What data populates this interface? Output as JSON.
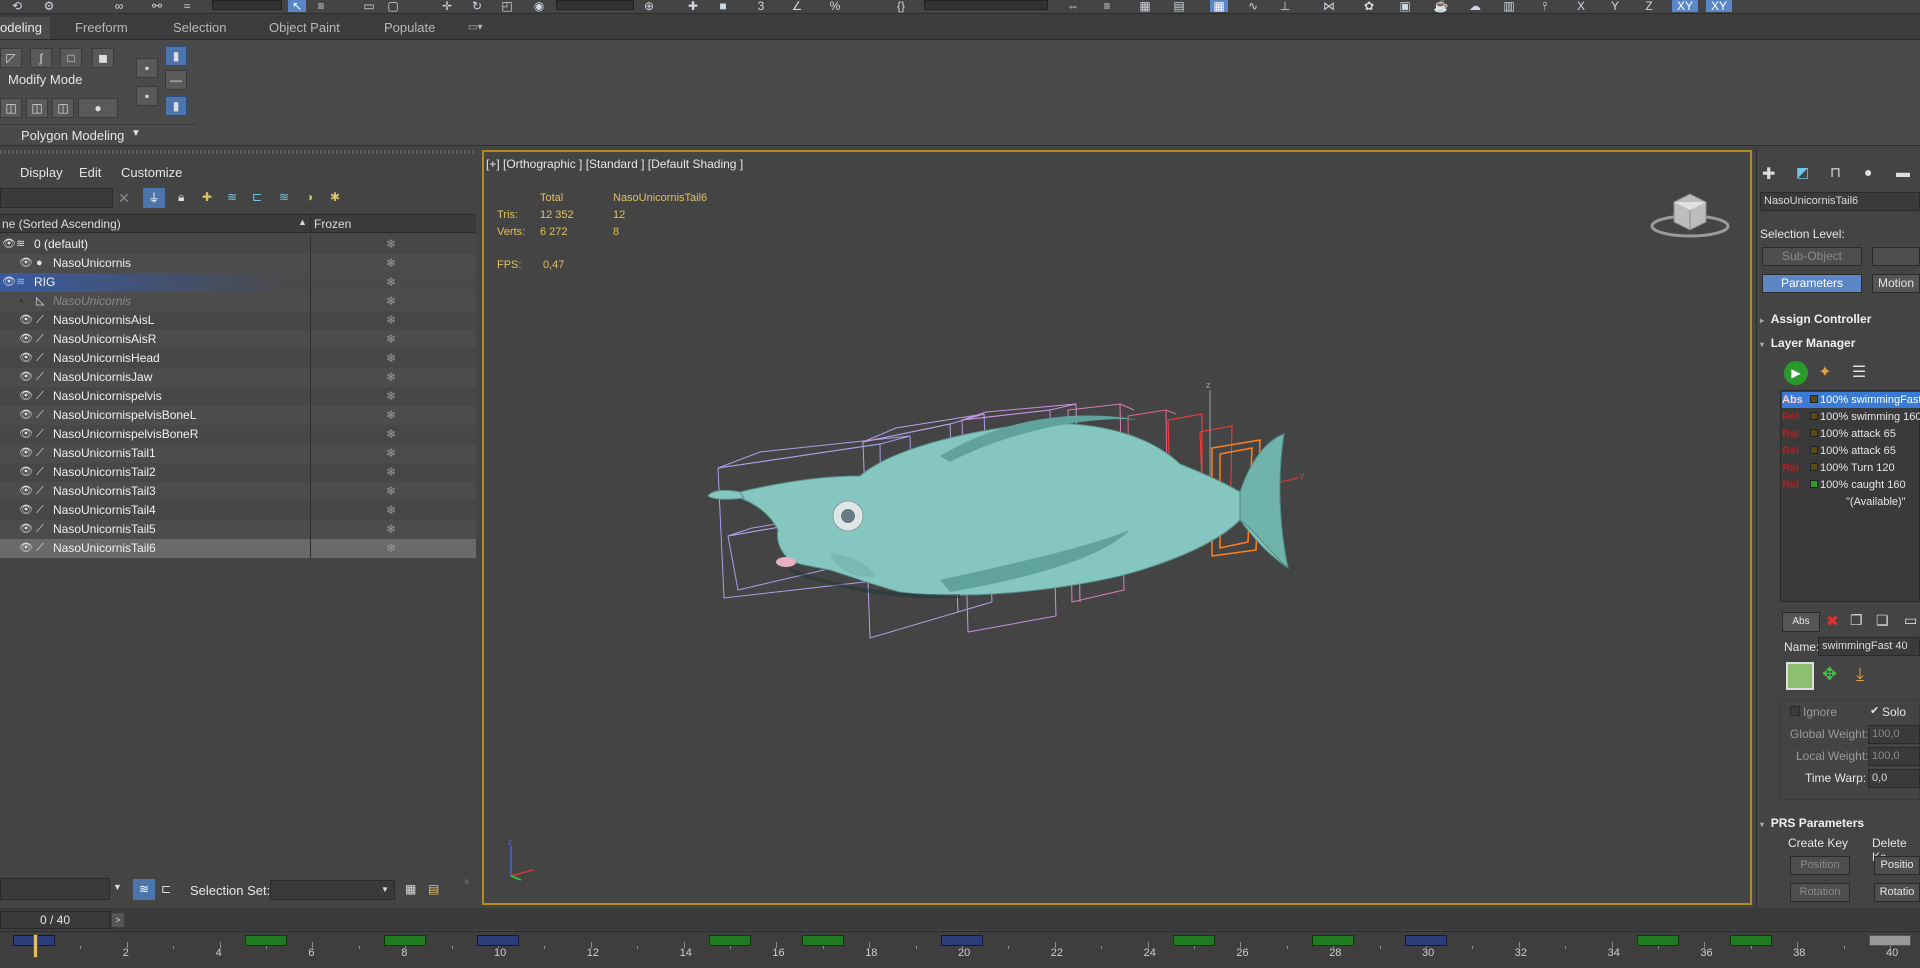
{
  "ribbon": {
    "tabs": [
      "odeling",
      "Freeform",
      "Selection",
      "Object Paint",
      "Populate"
    ],
    "modify_mode": "Modify Mode",
    "polygon_modeling": "Polygon Modeling"
  },
  "explorer": {
    "menu": [
      "Display",
      "Edit",
      "Customize"
    ],
    "header_name": "ne (Sorted Ascending)",
    "header_frozen": "Frozen",
    "rows": [
      {
        "name": "0 (default)",
        "indent": 0,
        "type": "layer"
      },
      {
        "name": "NasoUnicornis",
        "indent": 1,
        "type": "object"
      },
      {
        "name": "RIG",
        "indent": 0,
        "type": "layer-selected"
      },
      {
        "name": "NasoUnicornis",
        "indent": 1,
        "type": "hidden"
      },
      {
        "name": "NasoUnicornisAisL",
        "indent": 1,
        "type": "bone"
      },
      {
        "name": "NasoUnicornisAisR",
        "indent": 1,
        "type": "bone"
      },
      {
        "name": "NasoUnicornisHead",
        "indent": 1,
        "type": "bone"
      },
      {
        "name": "NasoUnicornisJaw",
        "indent": 1,
        "type": "bone"
      },
      {
        "name": "NasoUnicornispelvis",
        "indent": 1,
        "type": "bone"
      },
      {
        "name": "NasoUnicornispelvisBoneL",
        "indent": 1,
        "type": "bone"
      },
      {
        "name": "NasoUnicornispelvisBoneR",
        "indent": 1,
        "type": "bone"
      },
      {
        "name": "NasoUnicornisTail1",
        "indent": 1,
        "type": "bone"
      },
      {
        "name": "NasoUnicornisTail2",
        "indent": 1,
        "type": "bone"
      },
      {
        "name": "NasoUnicornisTail3",
        "indent": 1,
        "type": "bone"
      },
      {
        "name": "NasoUnicornisTail4",
        "indent": 1,
        "type": "bone"
      },
      {
        "name": "NasoUnicornisTail5",
        "indent": 1,
        "type": "bone"
      },
      {
        "name": "NasoUnicornisTail6",
        "indent": 1,
        "type": "bone-selected"
      }
    ],
    "selection_set_label": "Selection Set:",
    "frame_counter": "0 / 40"
  },
  "viewport": {
    "label": "[+] [Orthographic ] [Standard ] [Default Shading ]",
    "stats": {
      "col_total": "Total",
      "col_obj": "NasoUnicornisTail6",
      "tris_label": "Tris:",
      "tris_total": "12 352",
      "tris_obj": "12",
      "verts_label": "Verts:",
      "verts_total": "6 272",
      "verts_obj": "8",
      "fps_label": "FPS:",
      "fps_value": "0,47"
    }
  },
  "command_panel": {
    "object_name": "NasoUnicornisTail6",
    "selection_level": "Selection Level:",
    "sub_object": "Sub-Object",
    "parameters": "Parameters",
    "motion": "Motion",
    "assign_controller": "Assign Controller",
    "layer_manager": "Layer Manager",
    "layers": [
      {
        "tag": "Abs",
        "text": "100% swimmingFast",
        "selected": true,
        "swatch": "#5c4a14"
      },
      {
        "tag": "Rel",
        "text": "100% swimming 160",
        "selected": false,
        "swatch": "#5c4a14"
      },
      {
        "tag": "Rel",
        "text": "100% attack 65",
        "selected": false,
        "swatch": "#5c4a14"
      },
      {
        "tag": "Rel",
        "text": "100% attack 65",
        "selected": false,
        "swatch": "#5c4a14"
      },
      {
        "tag": "Rel",
        "text": "100% Turn 120",
        "selected": false,
        "swatch": "#5c4a14"
      },
      {
        "tag": "Rel",
        "text": "100% caught 160",
        "selected": false,
        "swatch": "#2aa02a"
      },
      {
        "tag": "",
        "text": "\"(Available)\"",
        "selected": false,
        "swatch": ""
      }
    ],
    "abs_button": "Abs",
    "name_label": "Name:",
    "name_value": "swimmingFast 40",
    "ignore": "Ignore",
    "solo": "Solo",
    "global_weight_label": "Global Weight:",
    "global_weight": "100,0",
    "local_weight_label": "Local Weight:",
    "local_weight": "100,0",
    "time_warp_label": "Time Warp:",
    "time_warp": "0,0",
    "prs_parameters": "PRS Parameters",
    "create_key": "Create Key",
    "delete_key": "Delete Ke",
    "position": "Position",
    "rotation": "Rotation",
    "position_r": "Positio",
    "rotation_r": "Rotatio"
  },
  "timeline": {
    "ticks": [
      "2",
      "4",
      "6",
      "8",
      "10",
      "12",
      "14",
      "16",
      "18",
      "20",
      "22",
      "24",
      "26",
      "28",
      "30",
      "32",
      "34",
      "36",
      "38",
      "40"
    ]
  },
  "colors": {
    "viewport_border": "#b08c22",
    "selection_blue": "#3a7bd5",
    "stats_yellow": "#e0c060",
    "key_green": "#207a20"
  }
}
